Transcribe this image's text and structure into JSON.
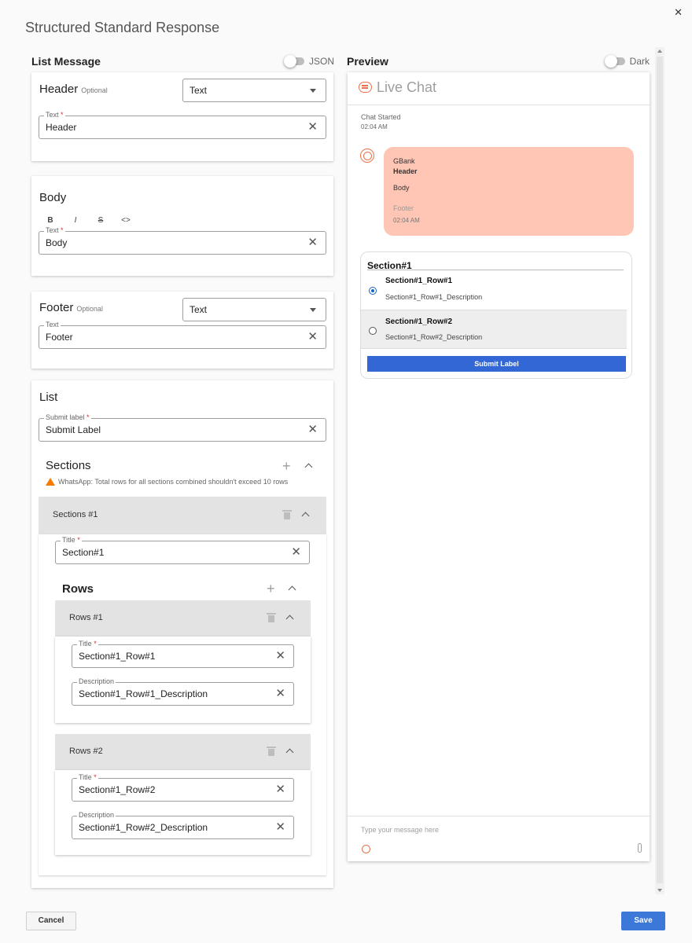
{
  "dialog": {
    "title": "Structured Standard Response",
    "close_glyph": "✕",
    "cancel_label": "Cancel",
    "save_label": "Save"
  },
  "left": {
    "heading": "List Message",
    "toggle_label": "JSON",
    "header": {
      "title": "Header",
      "optional": "Optional",
      "type_value": "Text",
      "text_label": "Text",
      "text_value": "Header"
    },
    "body": {
      "title": "Body",
      "format_buttons": [
        "B",
        "I",
        "S",
        "<>"
      ],
      "text_label": "Text",
      "text_value": "Body"
    },
    "footer": {
      "title": "Footer",
      "optional": "Optional",
      "type_value": "Text",
      "text_label": "Text",
      "text_value": "Footer"
    },
    "list": {
      "title": "List",
      "submit_label_label": "Submit label",
      "submit_label_value": "Submit Label",
      "sections_title": "Sections",
      "warning": "WhatsApp: Total rows for all sections combined shouldn't exceed 10 rows",
      "section": {
        "panel_label": "Sections #1",
        "title_label": "Title",
        "title_value": "Section#1",
        "rows_title": "Rows",
        "rows": [
          {
            "panel_label": "Rows #1",
            "title_label": "Title",
            "title_value": "Section#1_Row#1",
            "desc_label": "Description",
            "desc_value": "Section#1_Row#1_Description"
          },
          {
            "panel_label": "Rows #2",
            "title_label": "Title",
            "title_value": "Section#1_Row#2",
            "desc_label": "Description",
            "desc_value": "Section#1_Row#2_Description"
          }
        ]
      }
    }
  },
  "right": {
    "heading": "Preview",
    "toggle_label": "Dark",
    "live_chat_title": "Live Chat",
    "chat_started": "Chat Started",
    "started_time": "02:04 AM",
    "bubble": {
      "sender": "GBank",
      "header": "Header",
      "body": "Body",
      "footer": "Footer",
      "time": "02:04 AM"
    },
    "list_preview": {
      "section_title": "Section#1",
      "rows": [
        {
          "title": "Section#1_Row#1",
          "description": "Section#1_Row#1_Description",
          "selected": true
        },
        {
          "title": "Section#1_Row#2",
          "description": "Section#1_Row#2_Description",
          "selected": false
        }
      ],
      "submit_label": "Submit Label"
    },
    "composer_placeholder": "Type your message here"
  },
  "colors": {
    "accent": "#3c78d8",
    "bubble": "#ffc6b6",
    "brand_icon": "#e8734a",
    "warning": "#f57c00"
  }
}
